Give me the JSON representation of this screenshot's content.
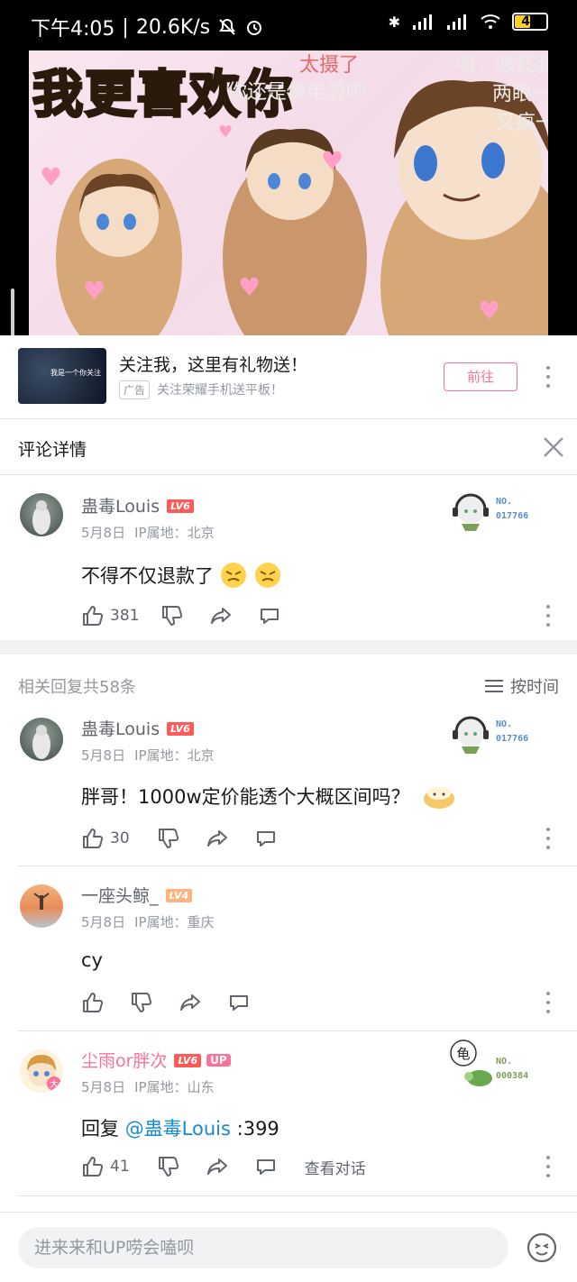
{
  "status_bar": {
    "time": "下午4:05",
    "speed": "20.6K/s",
    "battery": "48"
  },
  "video": {
    "title_overlay": "我更喜欢你",
    "danmaku": [
      "太摄了",
      "你还是做电源吧",
      "噫，咳死我大",
      "两眼一黑",
      "又疯一个"
    ]
  },
  "ad": {
    "thumb_text": "我是一个你关注",
    "title": "关注我，这里有礼物送！",
    "tag": "广告",
    "subtitle": "关注荣耀手机送平板！",
    "button": "前往"
  },
  "detail": {
    "title": "评论详情"
  },
  "main_comment": {
    "username": "蛊毒Louis",
    "level": "LV6",
    "date": "5月8日",
    "location": "IP属地：北京",
    "content": "不得不仅退款了",
    "likes": "381",
    "fan_no": "NO.",
    "fan_num": "017766"
  },
  "replies": {
    "count_label": "相关回复共58条",
    "sort_label": "按时间",
    "items": [
      {
        "username": "蛊毒Louis",
        "level": "LV6",
        "date": "5月8日",
        "location": "IP属地：北京",
        "content": "胖哥！1000w定价能透个大概区间吗？",
        "likes": "30",
        "fan_no": "NO.",
        "fan_num": "017766"
      },
      {
        "username": "一座头鲸_",
        "level": "LV4",
        "date": "5月8日",
        "location": "IP属地：重庆",
        "content": "cy",
        "likes": ""
      },
      {
        "username": "尘雨or胖次",
        "level": "LV6",
        "up_tag": "UP",
        "date": "5月8日",
        "location": "IP属地：山东",
        "content_prefix": "回复 ",
        "mention": "@蛊毒Louis",
        "content_suffix": " :399",
        "likes": "41",
        "view_conversation": "查看对话",
        "fan_no": "NO.",
        "fan_num": "000384",
        "badge_char": "龟"
      }
    ]
  },
  "input": {
    "placeholder": "进来来和UP唠会嗑呗"
  },
  "colors": {
    "brand_pink": "#fb7299",
    "lv6": "#ff5a5a",
    "lv4": "#ffb37c",
    "mention": "#178bcf"
  }
}
